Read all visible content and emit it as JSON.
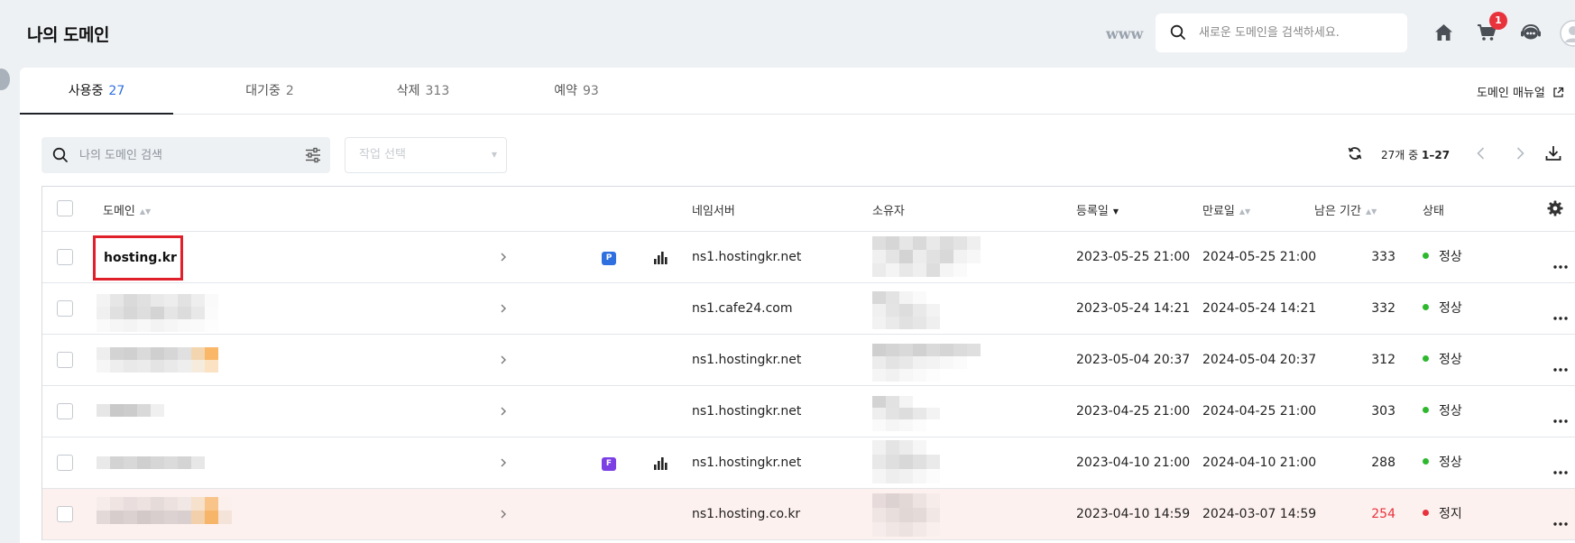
{
  "header": {
    "title": "나의 도메인",
    "www_label": "www",
    "search_placeholder": "새로운 도메인을 검색하세요.",
    "cart_count": "1"
  },
  "tabs": [
    {
      "label": "사용중",
      "count": "27",
      "active": true
    },
    {
      "label": "대기중",
      "count": "2",
      "active": false
    },
    {
      "label": "삭제",
      "count": "313",
      "active": false
    },
    {
      "label": "예약",
      "count": "93",
      "active": false
    }
  ],
  "manual_link": "도메인 매뉴얼",
  "toolbar": {
    "search_placeholder": "나의 도메인 검색",
    "action_placeholder": "작업 선택",
    "range_prefix": "27개 중",
    "range_value": "1–27"
  },
  "columns": {
    "domain": "도메인",
    "nameserver": "네임서버",
    "owner": "소유자",
    "registered": "등록일",
    "expires": "만료일",
    "remaining": "남은 기간",
    "status": "상태"
  },
  "rows": [
    {
      "domain": "hosting.kr",
      "badge": "P",
      "nameserver": "ns1.hostingkr.net",
      "registered": "2023-05-25 21:00",
      "expires": "2024-05-25 21:00",
      "remaining": "333",
      "status": "정상",
      "state": "ok"
    },
    {
      "domain": "",
      "badge": "",
      "nameserver": "ns1.cafe24.com",
      "registered": "2023-05-24 14:21",
      "expires": "2024-05-24 14:21",
      "remaining": "332",
      "status": "정상",
      "state": "ok"
    },
    {
      "domain": "",
      "badge": "",
      "nameserver": "ns1.hostingkr.net",
      "registered": "2023-05-04 20:37",
      "expires": "2024-05-04 20:37",
      "remaining": "312",
      "status": "정상",
      "state": "ok"
    },
    {
      "domain": "",
      "badge": "",
      "nameserver": "ns1.hostingkr.net",
      "registered": "2023-04-25 21:00",
      "expires": "2024-04-25 21:00",
      "remaining": "303",
      "status": "정상",
      "state": "ok"
    },
    {
      "domain": "",
      "badge": "F",
      "nameserver": "ns1.hostingkr.net",
      "registered": "2023-04-10 21:00",
      "expires": "2024-04-10 21:00",
      "remaining": "288",
      "status": "정상",
      "state": "ok"
    },
    {
      "domain": "",
      "badge": "",
      "nameserver": "ns1.hosting.co.kr",
      "registered": "2023-04-10 14:59",
      "expires": "2024-03-07 14:59",
      "remaining": "254",
      "status": "정지",
      "state": "stopped"
    }
  ],
  "colors": {
    "accent_blue": "#2f6fe0",
    "badge_purple": "#7b3fe4",
    "status_ok": "#2eb82e",
    "status_stopped": "#e8323c",
    "highlight_border": "#e0202a",
    "stopped_row_bg": "#fdf1ef"
  }
}
